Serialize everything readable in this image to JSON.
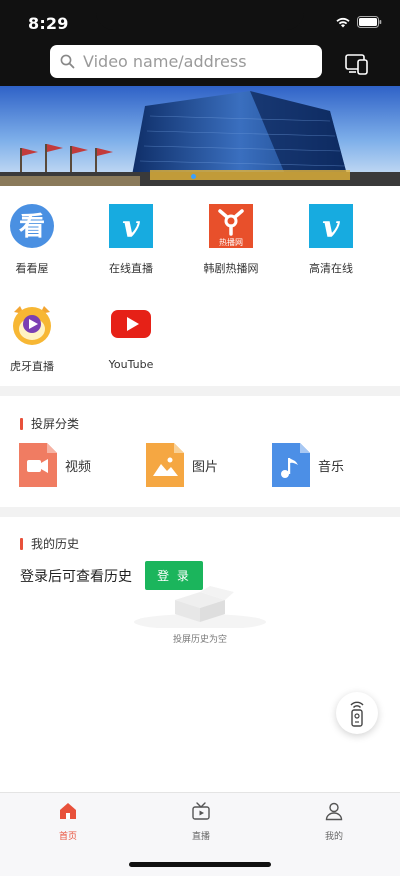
{
  "status": {
    "time": "8:29"
  },
  "search": {
    "placeholder": "Video name/address"
  },
  "apps": [
    {
      "label": "看看屋",
      "icon": "kankanwu-icon"
    },
    {
      "label": "在线直播",
      "icon": "vimeo-icon"
    },
    {
      "label": "韩剧热播网",
      "icon": "hanju-icon"
    },
    {
      "label": "高清在线",
      "icon": "vimeo-icon"
    },
    {
      "label": "虎牙直播",
      "icon": "huya-icon"
    },
    {
      "label": "YouTube",
      "icon": "youtube-icon"
    }
  ],
  "cast": {
    "title": "投屏分类",
    "categories": [
      {
        "label": "视频",
        "icon": "video-file-icon"
      },
      {
        "label": "图片",
        "icon": "image-file-icon"
      },
      {
        "label": "音乐",
        "icon": "music-file-icon"
      }
    ]
  },
  "history": {
    "title": "我的历史",
    "message": "登录后可查看历史",
    "login_label": "登 录",
    "empty_text": "投屏历史为空"
  },
  "tabs": [
    {
      "label": "首页",
      "icon": "home-icon",
      "active": true
    },
    {
      "label": "直播",
      "icon": "tv-icon",
      "active": false
    },
    {
      "label": "我的",
      "icon": "user-icon",
      "active": false
    }
  ],
  "colors": {
    "accent": "#e8513b",
    "login": "#1bb55c",
    "vimeo": "#17abe0"
  }
}
